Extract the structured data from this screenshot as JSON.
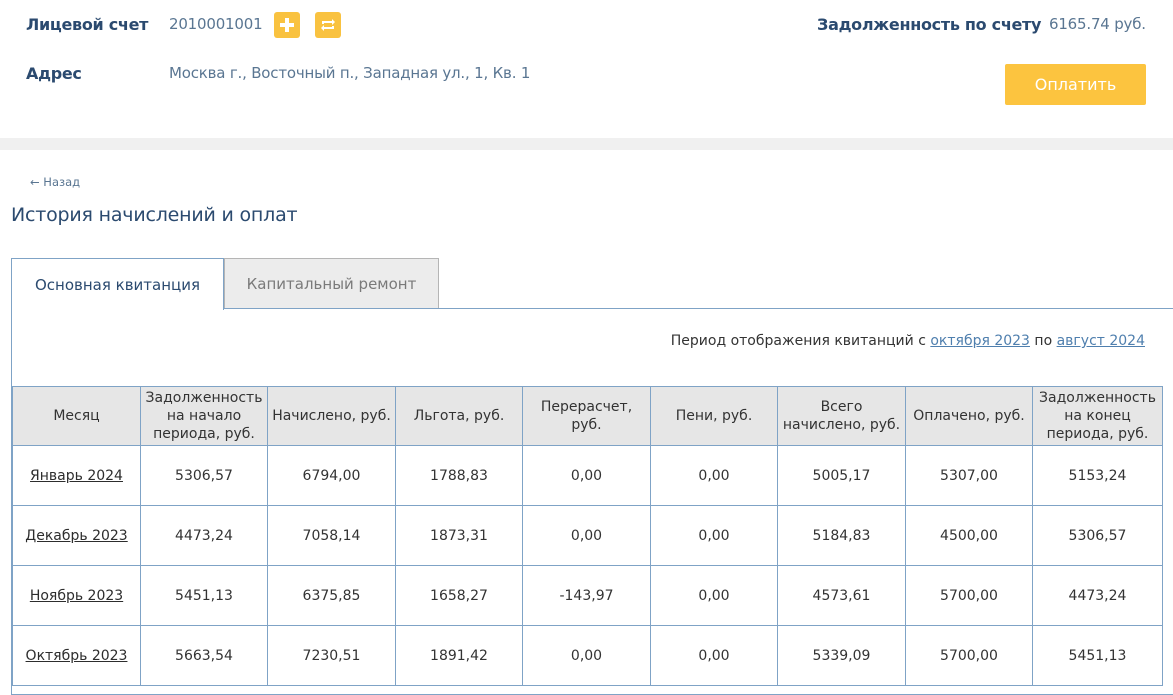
{
  "account": {
    "label": "Лицевой счет",
    "number": "2010001001",
    "address_label": "Адрес",
    "address": "Москва г., Восточный п., Западная ул., 1, Кв. 1",
    "debt_label": "Задолженность по счету",
    "debt_value": "6165.74 руб.",
    "pay_button": "Оплатить",
    "add_icon": "plus-icon",
    "switch_icon": "swap-icon",
    "accent_color": "#fcc43f"
  },
  "nav": {
    "back": "← Назад"
  },
  "page": {
    "title": "История начислений и оплат"
  },
  "tabs": [
    {
      "label": "Основная квитанция",
      "active": true
    },
    {
      "label": "Капитальный ремонт",
      "active": false
    }
  ],
  "period": {
    "prefix": "Период отображения квитанций с",
    "from": "октября 2023",
    "middle": "по",
    "to": "август 2024"
  },
  "table": {
    "headers": [
      "Месяц",
      "Задолженность на начало периода, руб.",
      "Начислено, руб.",
      "Льгота, руб.",
      "Перерасчет, руб.",
      "Пени, руб.",
      "Всего начислено, руб.",
      "Оплачено, руб.",
      "Задолженность на конец периода, руб."
    ],
    "rows": [
      [
        "Январь 2024",
        "5306,57",
        "6794,00",
        "1788,83",
        "0,00",
        "0,00",
        "5005,17",
        "5307,00",
        "5153,24"
      ],
      [
        "Декабрь 2023",
        "4473,24",
        "7058,14",
        "1873,31",
        "0,00",
        "0,00",
        "5184,83",
        "4500,00",
        "5306,57"
      ],
      [
        "Ноябрь 2023",
        "5451,13",
        "6375,85",
        "1658,27",
        "-143,97",
        "0,00",
        "4573,61",
        "5700,00",
        "4473,24"
      ],
      [
        "Октябрь 2023",
        "5663,54",
        "7230,51",
        "1891,42",
        "0,00",
        "0,00",
        "5339,09",
        "5700,00",
        "5451,13"
      ]
    ]
  }
}
